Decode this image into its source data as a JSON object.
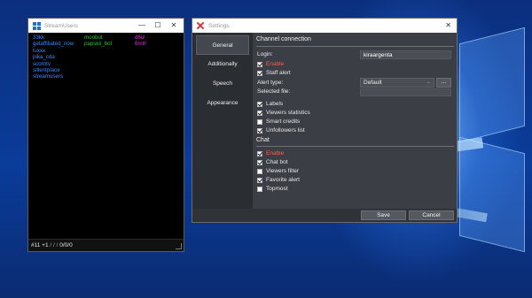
{
  "stream_users": {
    "title": "StreamUsers",
    "window_controls": {
      "minimize": "—",
      "maximize": "☐",
      "close": "✕"
    },
    "columns": {
      "blue": [
        "33kk",
        "getaffiliated_now",
        "luxxx",
        "pika_cda",
        "scorntv",
        "sillentplace",
        "streamusers"
      ],
      "green": [
        "moobot",
        "papskii_bot"
      ],
      "magenta": [
        "d6iz",
        "6mill"
      ]
    },
    "status": {
      "count": "#11 +1",
      "slashes": "/ / /",
      "ratio": "0/0/0"
    },
    "colors": {
      "blue": "#2f8cff",
      "green": "#22c22a",
      "magenta": "#d22ad2"
    }
  },
  "settings": {
    "title": "Settings",
    "close_symbol": "✕",
    "tabs": [
      "General",
      "Additionally",
      "Speech",
      "Appearance"
    ],
    "active_tab": "General",
    "channel_section": {
      "header": "Channel connection",
      "login_label": "Login:",
      "login_value": "kiraargenta",
      "enable_label": "Enable",
      "staff_alert_label": "Staff alert",
      "alert_type_label": "Alert type:",
      "alert_type_value": "Default",
      "alert_arrow": "–",
      "browse_label": "...",
      "selected_file_label": "Selected file:",
      "options": [
        {
          "label": "Labels",
          "checked": true
        },
        {
          "label": "Viewers statistics",
          "checked": true
        },
        {
          "label": "Smart credits",
          "checked": false
        },
        {
          "label": "Unfollowers list",
          "checked": true
        }
      ]
    },
    "chat_section": {
      "header": "Chat",
      "enable_label": "Enable",
      "options": [
        {
          "label": "Chat bot",
          "checked": true
        },
        {
          "label": "Viewers filter",
          "checked": false
        },
        {
          "label": "Favorite alert",
          "checked": true
        },
        {
          "label": "Topmost",
          "checked": false
        }
      ]
    },
    "buttons": {
      "save": "Save",
      "cancel": "Cancel"
    }
  }
}
